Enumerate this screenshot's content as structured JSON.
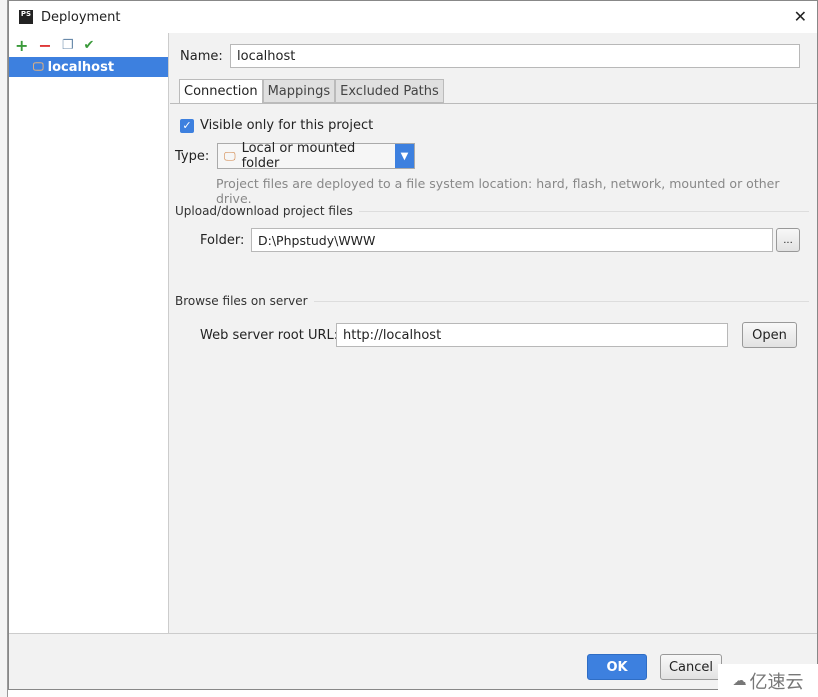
{
  "window": {
    "title": "Deployment",
    "app_icon": "PS"
  },
  "toolbar": {
    "icons": [
      "add-icon",
      "remove-icon",
      "copy-icon",
      "set-default-icon"
    ]
  },
  "servers": [
    {
      "label": "localhost",
      "selected": true
    }
  ],
  "name": {
    "label": "Name:",
    "value": "localhost"
  },
  "tabs": [
    {
      "label": "Connection",
      "active": true
    },
    {
      "label": "Mappings"
    },
    {
      "label": "Excluded Paths"
    }
  ],
  "connection": {
    "visible_only": {
      "label": "Visible only for this project",
      "checked": true
    },
    "type": {
      "label": "Type:",
      "value": "Local or mounted folder",
      "hint": "Project files are deployed to a file system location: hard, flash, network, mounted or other drive."
    },
    "upload_section": "Upload/download project files",
    "folder": {
      "label": "Folder:",
      "value": "D:\\Phpstudy\\WWW",
      "browse": "..."
    },
    "browse_section": "Browse files on server",
    "web_root": {
      "label": "Web server root URL:",
      "value": "http://localhost",
      "open": "Open"
    }
  },
  "footer": {
    "ok": "OK",
    "cancel": "Cancel"
  },
  "watermark": "亿速云",
  "colors": {
    "accent": "#3d80df"
  }
}
